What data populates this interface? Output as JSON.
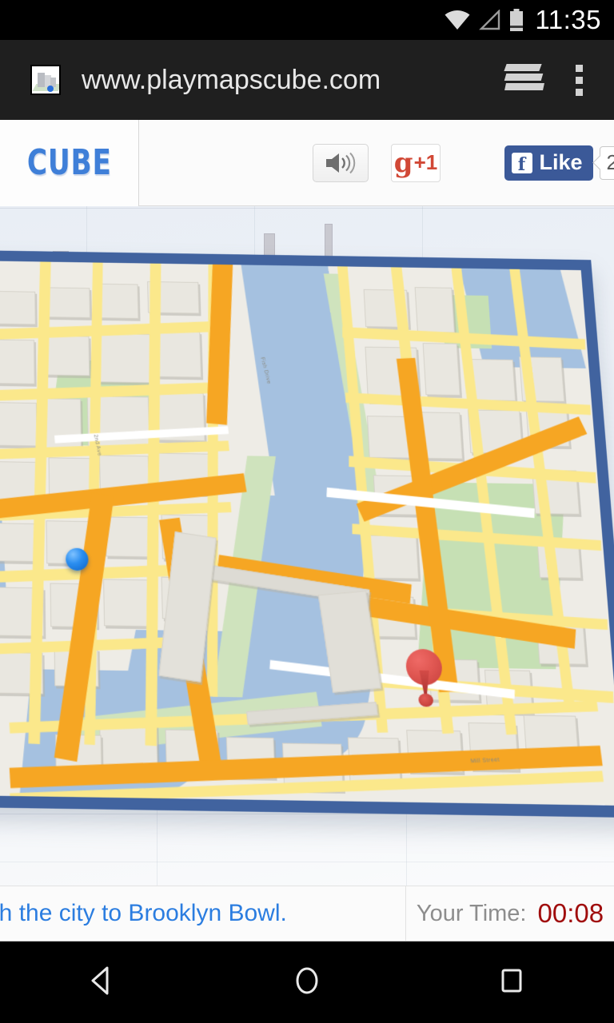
{
  "status_bar": {
    "time": "11:35",
    "icons": [
      "wifi-icon",
      "cell-signal-icon",
      "battery-icon"
    ]
  },
  "browser": {
    "url": "www.playmapscube.com",
    "favicon_name": "maps-cube-favicon",
    "tabs_icon": "tabs-stack-icon",
    "menu_icon": "overflow-menu-icon"
  },
  "site_header": {
    "logo": "CUBE",
    "sound_button_label": "speaker-icon",
    "gplus": {
      "g": "g",
      "plus_one": "+1"
    },
    "facebook": {
      "label": "Like",
      "f_glyph": "f",
      "count": "2"
    }
  },
  "game": {
    "player_marker": "blue-ball",
    "destination_marker": "red-map-pin",
    "rotate_control": "rotate-left-arrow",
    "street_labels": [
      "Fish Drive",
      "2nd Ave",
      "Mill Street"
    ]
  },
  "hud": {
    "message": "gh the city to Brooklyn Bowl.",
    "time_label": "Your Time:",
    "time_value": "00:08"
  },
  "nav_bar": {
    "back": "back-triangle-icon",
    "home": "home-circle-icon",
    "recents": "recents-square-icon"
  },
  "colors": {
    "cube_border": "#41639f",
    "water": "#a5c1e0",
    "park": "#c6e0b4",
    "road_yellow": "#fbe88b",
    "road_orange": "#f6a623",
    "pin_red": "#d9534f",
    "ball_blue": "#2b8ef0",
    "facebook_blue": "#3b5998",
    "gplus_red": "#d14836",
    "hud_link_blue": "#2b7de0",
    "timer_red": "#a00d0d"
  }
}
